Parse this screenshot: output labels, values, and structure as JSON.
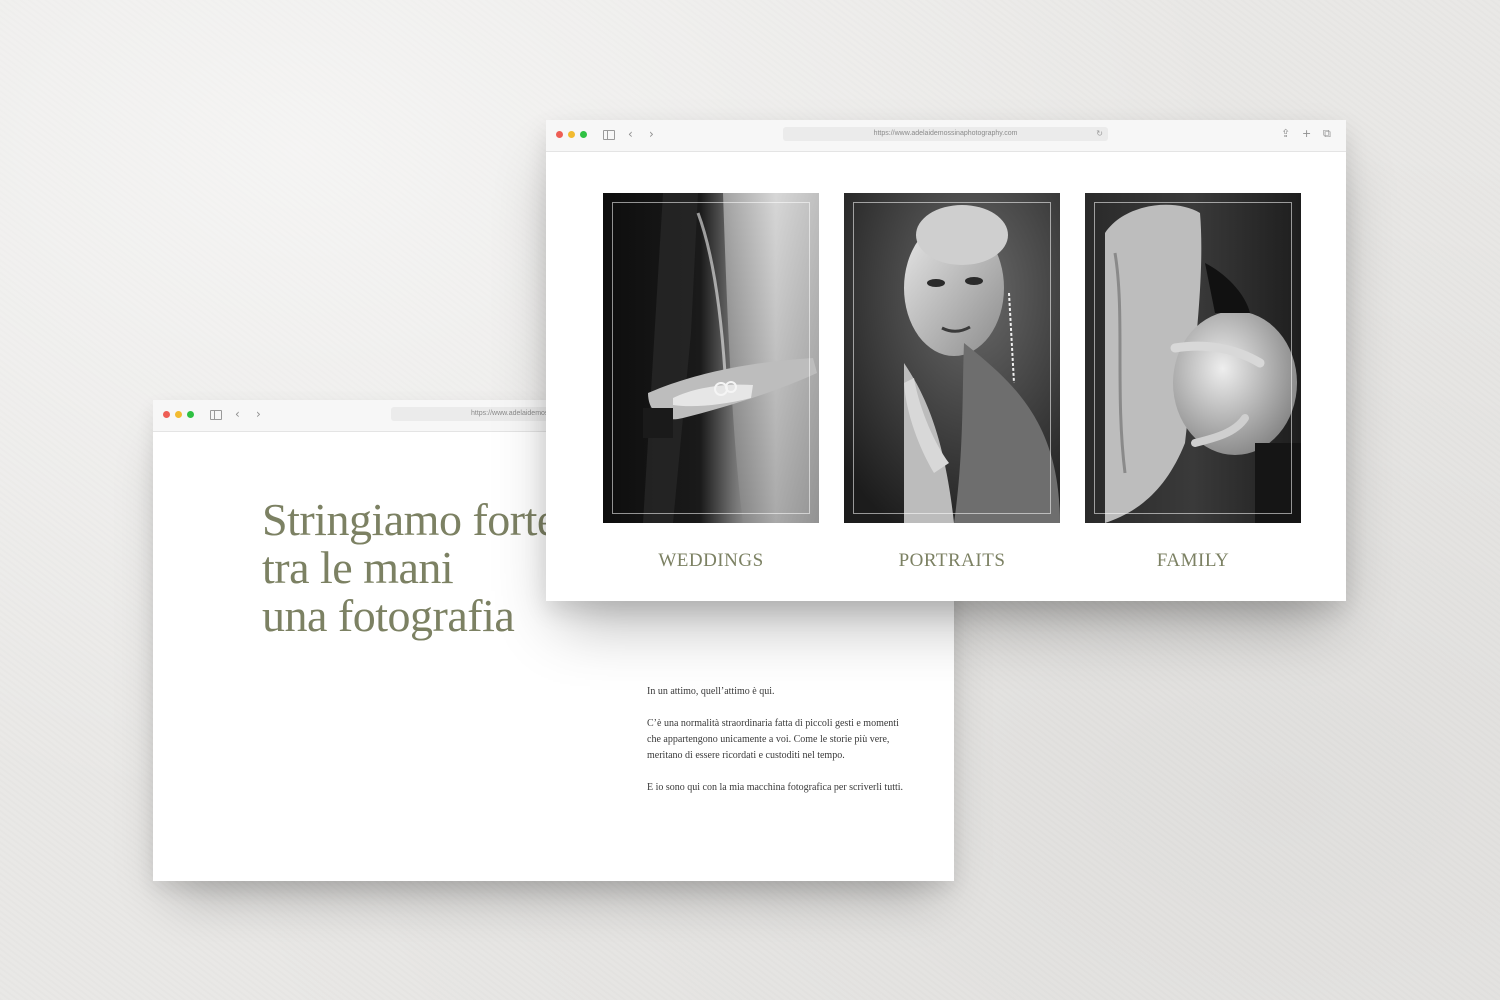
{
  "browser_back": {
    "url": "https://www.adelaidemossinaphotography.com",
    "icons": {
      "sidebar": "sidebar-icon",
      "back": "chevron-left-icon",
      "forward": "chevron-right-icon"
    }
  },
  "browser_front": {
    "url": "https://www.adelaidemossinaphotography.com",
    "icons": {
      "sidebar": "sidebar-icon",
      "back": "chevron-left-icon",
      "forward": "chevron-right-icon",
      "reload": "reload-icon",
      "share": "share-icon",
      "new_tab": "plus-icon",
      "tabs": "tabs-icon"
    }
  },
  "hero": {
    "title_lines": [
      "Stringiamo forte",
      "tra le mani",
      "una fotografia"
    ],
    "paragraphs": [
      "In un attimo, quell’attimo è qui.",
      "C’è una normalità straordinaria fatta di piccoli gesti e momenti che appartengono unicamente a voi. Come le storie più vere, meritano di essere ricordati e custoditi nel tempo.",
      "E io sono qui con la mia macchina fotografica per scriverli tutti."
    ]
  },
  "gallery": {
    "categories": [
      {
        "label": "WEDDINGS",
        "image": "wedding-rings-hands-photo"
      },
      {
        "label": "PORTRAITS",
        "image": "woman-portrait-photo"
      },
      {
        "label": "FAMILY",
        "image": "maternity-belly-photo"
      }
    ]
  },
  "colors": {
    "accent_olive": "#7c8163",
    "body_text": "#3a3a3a",
    "traffic_red": "#ee5e55",
    "traffic_yellow": "#f2bb30",
    "traffic_green": "#2fc143"
  }
}
